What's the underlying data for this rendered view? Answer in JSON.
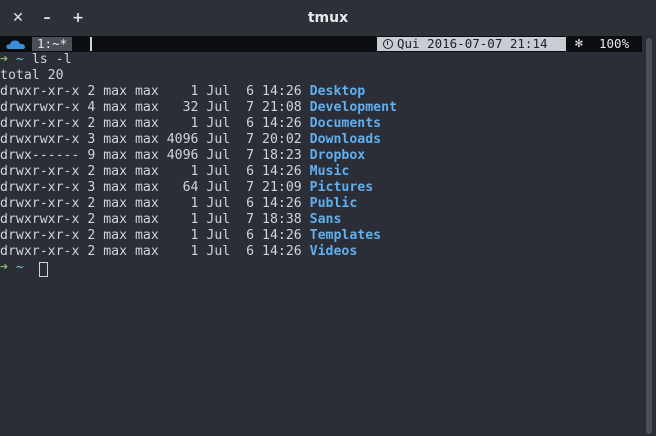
{
  "window": {
    "title": "tmux",
    "close_label": "✕",
    "minimize_label": "–",
    "maximize_label": "+"
  },
  "statusbar": {
    "window_tab": "1:~*",
    "datetime": "Qui 2016-07-07 21:14",
    "snow_icon": "✻",
    "battery": "100%"
  },
  "prompt": {
    "arrow": "➜",
    "dir": "~"
  },
  "command": "ls -l",
  "total_line": "total 20",
  "listing": [
    {
      "meta": "drwxr-xr-x 2 max max    1 Jul  6 14:26 ",
      "name": "Desktop"
    },
    {
      "meta": "drwxrwxr-x 4 max max   32 Jul  7 21:08 ",
      "name": "Development"
    },
    {
      "meta": "drwxr-xr-x 2 max max    1 Jul  6 14:26 ",
      "name": "Documents"
    },
    {
      "meta": "drwxrwxr-x 3 max max 4096 Jul  7 20:02 ",
      "name": "Downloads"
    },
    {
      "meta": "drwx------ 9 max max 4096 Jul  7 18:23 ",
      "name": "Dropbox"
    },
    {
      "meta": "drwxr-xr-x 2 max max    1 Jul  6 14:26 ",
      "name": "Music"
    },
    {
      "meta": "drwxr-xr-x 3 max max   64 Jul  7 21:09 ",
      "name": "Pictures"
    },
    {
      "meta": "drwxr-xr-x 2 max max    1 Jul  6 14:26 ",
      "name": "Public"
    },
    {
      "meta": "drwxrwxr-x 2 max max    1 Jul  7 18:38 ",
      "name": "Sans"
    },
    {
      "meta": "drwxr-xr-x 2 max max    1 Jul  6 14:26 ",
      "name": "Templates"
    },
    {
      "meta": "drwxr-xr-x 2 max max    1 Jul  6 14:26 ",
      "name": "Videos"
    }
  ],
  "colors": {
    "background": "#2b2e36",
    "text": "#cfd3da",
    "directory": "#61afef",
    "prompt_arrow": "#8ebd6b",
    "prompt_dir": "#6cc4d9"
  }
}
